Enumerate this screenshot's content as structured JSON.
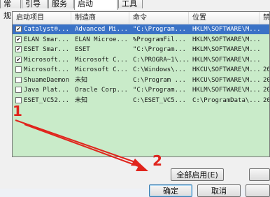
{
  "tabs": [
    "常规",
    "引导",
    "服务",
    "启动",
    "工具"
  ],
  "active_tab": "启动",
  "columns": [
    "启动项目",
    "制造商",
    "命令",
    "位置",
    "禁"
  ],
  "rows": [
    {
      "checked": true,
      "selected": true,
      "item": "Catalyst®...",
      "maker": "Advanced Mi...",
      "command": "\"C:\\Program...",
      "location": "HKLM\\SOFTWARE\\M...",
      "disabled": ""
    },
    {
      "checked": true,
      "selected": false,
      "item": "ELAN Smar...",
      "maker": "ELAN Microe...",
      "command": "%ProgramFil...",
      "location": "HKLM\\SOFTWARE\\M...",
      "disabled": ""
    },
    {
      "checked": true,
      "selected": false,
      "item": "ESET Smar...",
      "maker": "ESET",
      "command": "\"C:\\Program...",
      "location": "HKLM\\SOFTWARE\\M...",
      "disabled": ""
    },
    {
      "checked": true,
      "selected": false,
      "item": "Microsoft...",
      "maker": "Microsoft C...",
      "command": "C:\\PROGRA~1\\...",
      "location": "HKLM\\SOFTWARE\\M...",
      "disabled": ""
    },
    {
      "checked": false,
      "selected": false,
      "item": "Microsoft...",
      "maker": "Microsoft C...",
      "command": "C:\\Windows\\...",
      "location": "HKCU\\SOFTWARE\\M...",
      "disabled": "20"
    },
    {
      "checked": false,
      "selected": false,
      "item": "ShuameDaemon",
      "maker": "未知",
      "command": "C:\\Program ...",
      "location": "HKCU\\SOFTWARE\\M...",
      "disabled": "20"
    },
    {
      "checked": false,
      "selected": false,
      "item": "Java Plat...",
      "maker": "Oracle Corp...",
      "command": "\"C:\\Program...",
      "location": "HKLM\\SOFTWARE\\M...",
      "disabled": "20"
    },
    {
      "checked": false,
      "selected": false,
      "item": "ESET_VC52...",
      "maker": "未知",
      "command": "C:\\ESET_VC5...",
      "location": "C:\\ProgramData\\...",
      "disabled": "20"
    }
  ],
  "buttons": {
    "enable_all": "全部启用(E)",
    "ok": "确定",
    "cancel": "取消"
  },
  "annotations": {
    "one": "1",
    "two": "2"
  },
  "colors": {
    "annotation": "#e0241c",
    "list_bg": "#c9ebc9",
    "selection": "#3a72c6"
  }
}
